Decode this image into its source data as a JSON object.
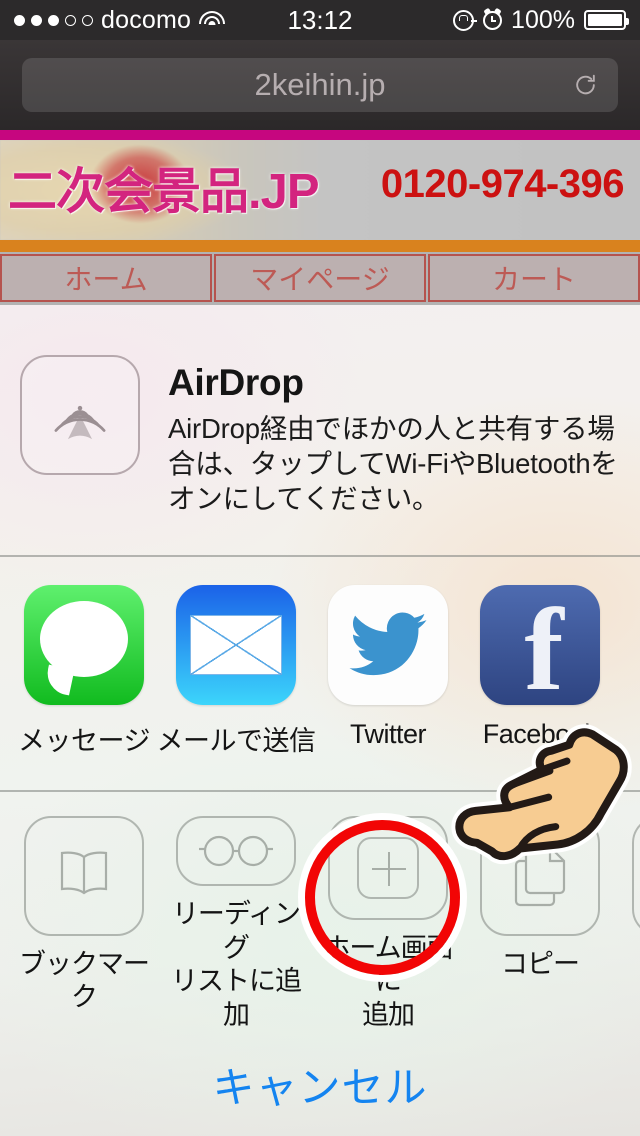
{
  "statusbar": {
    "signal_filled": 3,
    "signal_total": 5,
    "carrier": "docomo",
    "wifi_icon": "wifi-icon",
    "time": "13:12",
    "rotation_lock_icon": "rotation-lock-icon",
    "alarm_icon": "alarm-clock-icon",
    "battery_percent": "100%",
    "battery_level": 100
  },
  "browser": {
    "url": "2keihin.jp",
    "reload_icon": "reload-icon"
  },
  "website": {
    "logo_text": "二次会景品.JP",
    "phone": "0120-974-396",
    "nav": [
      {
        "label": "ホーム"
      },
      {
        "label": "マイページ"
      },
      {
        "label": "カート"
      }
    ],
    "colors": {
      "top_bar": "#c6067f",
      "orange_bar": "#d9821e",
      "logo": "#d3247f",
      "phone": "#cc1111",
      "nav_border": "#b5534e",
      "nav_text": "#bd5a55"
    }
  },
  "share_sheet": {
    "airdrop": {
      "icon": "airdrop-icon",
      "title": "AirDrop",
      "description": "AirDrop経由でほかの人と共有する場合は、タップしてWi-FiやBluetoothをオンにしてください。"
    },
    "apps": [
      {
        "icon": "messages-icon",
        "label": "メッセージ"
      },
      {
        "icon": "mail-icon",
        "label": "メールで送信"
      },
      {
        "icon": "twitter-icon",
        "label": "Twitter"
      },
      {
        "icon": "facebook-icon",
        "label": "Facebook"
      }
    ],
    "actions": [
      {
        "icon": "bookmark-icon",
        "label_line1": "ブックマーク",
        "label_line2": ""
      },
      {
        "icon": "glasses-icon",
        "label_line1": "リーディング",
        "label_line2": "リストに追加"
      },
      {
        "icon": "add-to-home-icon",
        "label_line1": "ホーム画面に",
        "label_line2": "追加"
      },
      {
        "icon": "copy-icon",
        "label_line1": "コピー",
        "label_line2": ""
      },
      {
        "icon": "more-icon",
        "label_line1": "",
        "label_line2": ""
      }
    ],
    "cancel_label": "キャンセル"
  },
  "annotations": {
    "highlight_circle_color": "#f20505",
    "highlight_target": "add-to-home-icon",
    "pointer_icon": "pointing-hand-icon"
  }
}
